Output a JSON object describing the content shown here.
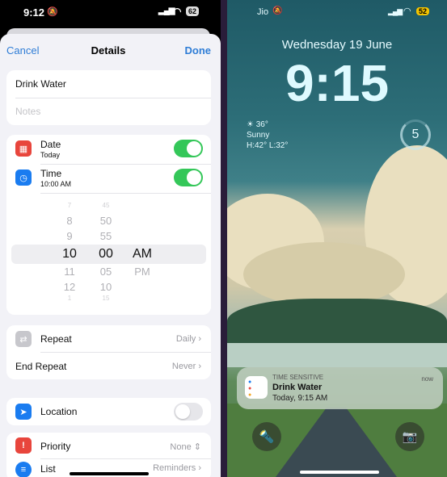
{
  "left": {
    "status": {
      "time": "9:12",
      "battery": "62"
    },
    "nav": {
      "cancel": "Cancel",
      "title": "Details",
      "done": "Done"
    },
    "title_field": "Drink Water",
    "notes_placeholder": "Notes",
    "date": {
      "label": "Date",
      "value": "Today",
      "enabled": true
    },
    "time": {
      "label": "Time",
      "value": "10:00 AM",
      "enabled": true
    },
    "picker": {
      "hours": [
        "7",
        "8",
        "9",
        "10",
        "11",
        "12",
        "1"
      ],
      "minutes": [
        "45",
        "50",
        "55",
        "00",
        "05",
        "10",
        "15"
      ],
      "periods": [
        "AM",
        "PM"
      ],
      "selected": {
        "hour": "10",
        "minute": "00",
        "period": "AM"
      }
    },
    "repeat": {
      "label": "Repeat",
      "value": "Daily"
    },
    "end_repeat": {
      "label": "End Repeat",
      "value": "Never"
    },
    "location": {
      "label": "Location",
      "enabled": false
    },
    "priority": {
      "label": "Priority",
      "value": "None"
    },
    "list": {
      "label": "List",
      "value": "Reminders"
    }
  },
  "right": {
    "status": {
      "carrier": "Jio",
      "battery": "52"
    },
    "date": "Wednesday 19 June",
    "time": "9:15",
    "weather": {
      "temp": "36°",
      "condition": "Sunny",
      "range": "H:42° L:32°"
    },
    "ring_value": "5",
    "notification": {
      "category": "TIME SENSITIVE",
      "title": "Drink Water",
      "body": "Today, 9:15 AM",
      "time": "now"
    }
  },
  "colors": {
    "accent": "#2f7dd6",
    "toggle_on": "#34c759",
    "date_icon": "#e8453c",
    "time_icon": "#1a7cf0",
    "priority_icon": "#e8453c"
  }
}
